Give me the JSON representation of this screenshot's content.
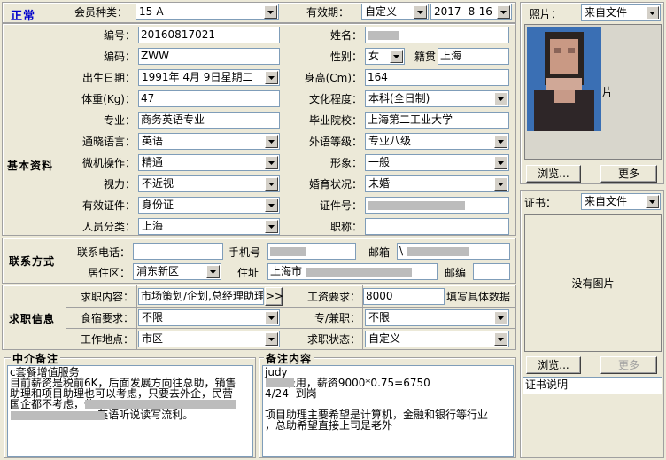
{
  "status_label": "正常",
  "member_type": {
    "label": "会员种类：",
    "value": "15-A"
  },
  "validity": {
    "label": "有效期：",
    "mode": "自定义",
    "date": "2017- 8-16"
  },
  "sections": {
    "basic": "基本资料",
    "contact": "联系方式",
    "job": "求职信息"
  },
  "basic": {
    "id_label": "编号：",
    "id_value": "20160817021",
    "code_label": "编码：",
    "code_value": "ZWW",
    "birth_label": "出生日期：",
    "birth_value": "1991年 4月 9日星期二",
    "weight_label": "体重(Kg)：",
    "weight_value": "47",
    "major_label": "专业：",
    "major_value": "商务英语专业",
    "lang_label": "通晓语言：",
    "lang_value": "英语",
    "computer_label": "微机操作：",
    "computer_value": "精通",
    "vision_label": "视力：",
    "vision_value": "不近视",
    "cert_type_label": "有效证件：",
    "cert_type_value": "身份证",
    "category_label": "人员分类：",
    "category_value": "上海",
    "name_label": "姓名：",
    "gender_label": "性别：",
    "gender_value": "女",
    "origin_label": "籍贯",
    "origin_value": "上海",
    "height_label": "身高(Cm)：",
    "height_value": "164",
    "edu_label": "文化程度：",
    "edu_value": "本科(全日制)",
    "school_label": "毕业院校：",
    "school_value": "上海第二工业大学",
    "lang_level_label": "外语等级：",
    "lang_level_value": "专业八级",
    "image_label": "形象：",
    "image_value": "一般",
    "marital_label": "婚育状况：",
    "marital_value": "未婚",
    "cert_no_label": "证件号：",
    "title_label": "职称："
  },
  "contact": {
    "phone_label": "联系电话：",
    "mobile_label": "手机号",
    "email_label": "邮箱",
    "email_value": "\\",
    "district_label": "居住区：",
    "district_value": "浦东新区",
    "address_label": "住址",
    "address_value": "上海市",
    "postcode_label": "邮编"
  },
  "job": {
    "content_label": "求职内容：",
    "content_value": "市场策划/企划,总经理助理",
    "more_btn": ">>",
    "salary_label": "工资要求：",
    "salary_value": "8000",
    "salary_hint": "填写具体数据",
    "lodging_label": "食宿要求：",
    "lodging_value": "不限",
    "parttime_label": "专/兼职：",
    "parttime_value": "不限",
    "location_label": "工作地点：",
    "location_value": "市区",
    "status_label": "求职状态：",
    "status_value": "自定义"
  },
  "notes": {
    "agent_title": "中介备注",
    "agent_text": "c套餐增值服务\n目前薪资是税前6K，后面发展方向往总助，销售\n助理和项目助理也可以考虑，只要去外企，民营\n国企都不考虑，住\n                          英语听说读写流利。",
    "remark_title": "备注内容",
    "remark_text": "judy\n      录用，薪资9000*0.75=6750\n4/24  到岗\n\n项目助理主要希望是计算机，金融和银行等行业\n，总助希望直接上司是老外"
  },
  "photo": {
    "label": "照片：",
    "source": "来自文件",
    "browse_btn": "浏览...",
    "more_btn": "更多",
    "partial_text": "片"
  },
  "certificate": {
    "label": "证书：",
    "source": "来自文件",
    "no_image": "没有图片",
    "browse_btn": "浏览...",
    "more_btn": "更多",
    "desc_label": "证书说明"
  }
}
